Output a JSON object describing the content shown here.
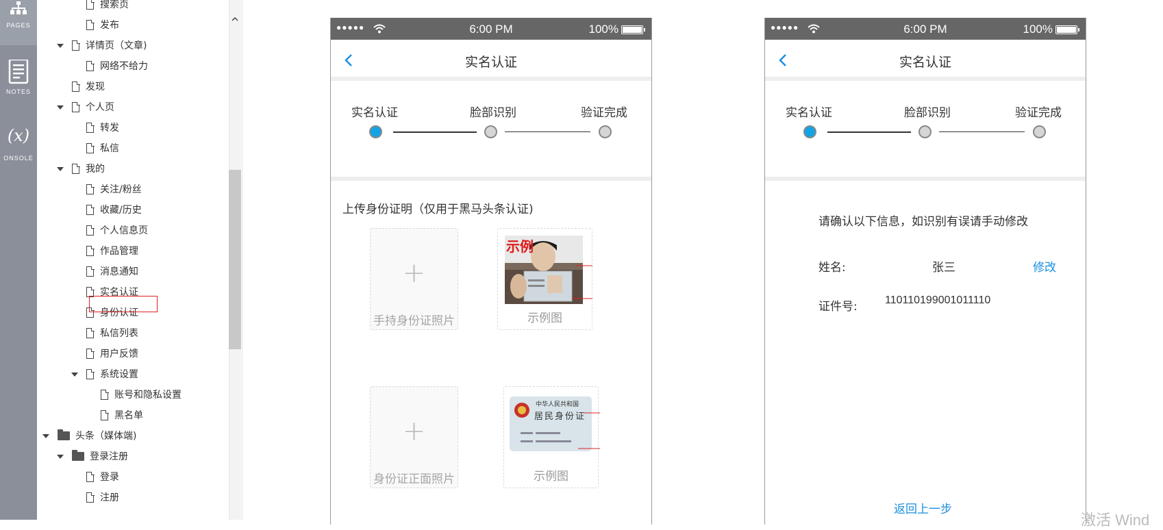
{
  "rail": {
    "items": [
      {
        "label": "PAGES",
        "icon": "sitemap-icon"
      },
      {
        "label": "NOTES",
        "icon": "notes-icon"
      },
      {
        "label": "ONSOLE",
        "icon_text": "(x)"
      }
    ]
  },
  "tree": {
    "items": [
      {
        "label": "搜索页",
        "type": "page"
      },
      {
        "label": "发布",
        "type": "page"
      },
      {
        "label": "详情页（文章)",
        "type": "page",
        "expanded": true
      },
      {
        "label": "网络不给力",
        "type": "page"
      },
      {
        "label": "发现",
        "type": "page"
      },
      {
        "label": "个人页",
        "type": "page",
        "expanded": true
      },
      {
        "label": "转发",
        "type": "page"
      },
      {
        "label": "私信",
        "type": "page"
      },
      {
        "label": "我的",
        "type": "page",
        "expanded": true
      },
      {
        "label": "关注/粉丝",
        "type": "page"
      },
      {
        "label": "收藏/历史",
        "type": "page"
      },
      {
        "label": "个人信息页",
        "type": "page"
      },
      {
        "label": "作品管理",
        "type": "page"
      },
      {
        "label": "消息通知",
        "type": "page"
      },
      {
        "label": "实名认证",
        "type": "page",
        "selected": true
      },
      {
        "label": "身份认证",
        "type": "page"
      },
      {
        "label": "私信列表",
        "type": "page"
      },
      {
        "label": "用户反馈",
        "type": "page"
      },
      {
        "label": "系统设置",
        "type": "page",
        "expanded": true
      },
      {
        "label": "账号和隐私设置",
        "type": "page"
      },
      {
        "label": "黑名单",
        "type": "page"
      },
      {
        "label": "头条（媒体端)",
        "type": "folder",
        "expanded": true
      },
      {
        "label": "登录注册",
        "type": "folder",
        "expanded": true
      },
      {
        "label": "登录",
        "type": "page"
      },
      {
        "label": "注册",
        "type": "page"
      }
    ]
  },
  "phone_left": {
    "status": {
      "dots": "●●●●●",
      "time": "6:00 PM",
      "battery": "100%"
    },
    "title": "实名认证",
    "steps": [
      "实名认证",
      "脸部识别",
      "验证完成"
    ],
    "active_step": 0,
    "upload_title": "上传身份证明（仅用于黑马头条认证)",
    "upload_handheld_caption": "手持身份证照片",
    "upload_front_caption": "身份证正面照片",
    "example_caption_1": "示例图",
    "example_caption_2": "示例图",
    "example_badge": "示例",
    "idcard_header": "中华人民共和国",
    "idcard_title": "居民身份证"
  },
  "phone_right": {
    "status": {
      "dots": "●●●●●",
      "time": "6:00 PM",
      "battery": "100%"
    },
    "title": "实名认证",
    "steps": [
      "实名认证",
      "脸部识别",
      "验证完成"
    ],
    "active_step": 0,
    "confirm_prompt": "请确认以下信息，如识别有误请手动修改",
    "name_label": "姓名:",
    "name_value": "张三",
    "edit_label": "修改",
    "id_label": "证件号:",
    "id_value": "110110199001011110",
    "back_link": "返回上一步"
  },
  "colors": {
    "accent": "#13a4e6",
    "link": "#1a8fe0",
    "statusbar": "#666666",
    "rail": "#8a8f99"
  },
  "watermark": "激活 Wind"
}
